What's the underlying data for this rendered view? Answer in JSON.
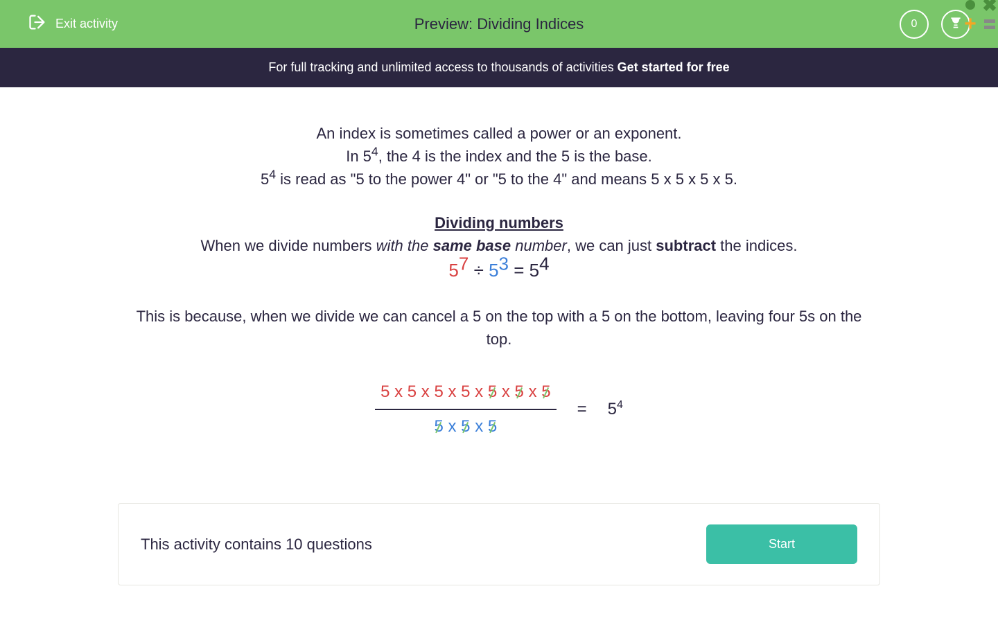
{
  "header": {
    "exit_label": "Exit activity",
    "title": "Preview: Dividing Indices",
    "score": "0"
  },
  "banner": {
    "text": "For full tracking and unlimited access to thousands of activities ",
    "cta": "Get started for free"
  },
  "content": {
    "line1": "An index is sometimes called a power or an exponent.",
    "line2_pre": "In 5",
    "line2_sup": "4",
    "line2_post": ", the 4 is the index and the 5 is the base.",
    "line3_pre": "5",
    "line3_sup": "4",
    "line3_post": " is read as \"5 to the power 4\" or \"5 to the 4\" and means 5 x 5 x 5 x 5.",
    "subheading": "Dividing numbers",
    "line4_a": "When we divide numbers ",
    "line4_b": "with the ",
    "line4_c": "same base",
    "line4_d": " number",
    "line4_e": ", we can just ",
    "line4_f": "subtract",
    "line4_g": " the indices.",
    "eq": {
      "base1": "5",
      "exp1": "7",
      "div": " ÷ ",
      "base2": "5",
      "exp2": "3",
      "eq": " = 5",
      "exp3": "4"
    },
    "line5": "This is because, when we divide we can cancel a 5 on the top with a 5 on the bottom, leaving four 5s on the top.",
    "fraction": {
      "top_plain": "5 x 5 x 5 x 5 x ",
      "top_cancel": [
        "5",
        "5",
        "5"
      ],
      "top_sep": " x ",
      "bot_cancel": [
        "5",
        "5",
        "5"
      ],
      "bot_sep": " x ",
      "equals": "=",
      "result_base": "5",
      "result_exp": "4"
    }
  },
  "footer": {
    "text": "This activity contains 10 questions",
    "button": "Start"
  }
}
